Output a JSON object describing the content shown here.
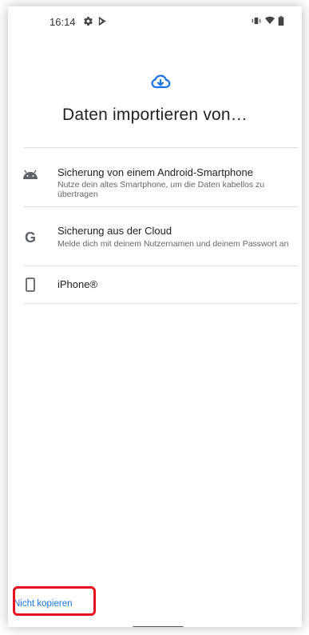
{
  "status_bar": {
    "time": "16:14",
    "icons": [
      "gear-icon",
      "play-store-icon",
      "vibrate-icon",
      "wifi-icon",
      "battery-icon"
    ]
  },
  "header": {
    "icon": "cloud-download-icon",
    "title": "Daten importieren von…"
  },
  "options": [
    {
      "icon": "android-icon",
      "title": "Sicherung von einem Android-Smartphone",
      "description": "Nutze dein altes Smartphone, um die Daten kabellos zu übertragen"
    },
    {
      "icon": "google-icon",
      "title": "Sicherung aus der Cloud",
      "description": "Melde dich mit deinem Nutzernamen und deinem Passwort an"
    },
    {
      "icon": "phone-icon",
      "title": "iPhone®"
    }
  ],
  "footer": {
    "skip_label": "Nicht kopieren"
  },
  "colors": {
    "accent": "#1a73e8",
    "highlight": "#e8121e",
    "icon_gray": "#5f6368",
    "text": "#222222"
  }
}
